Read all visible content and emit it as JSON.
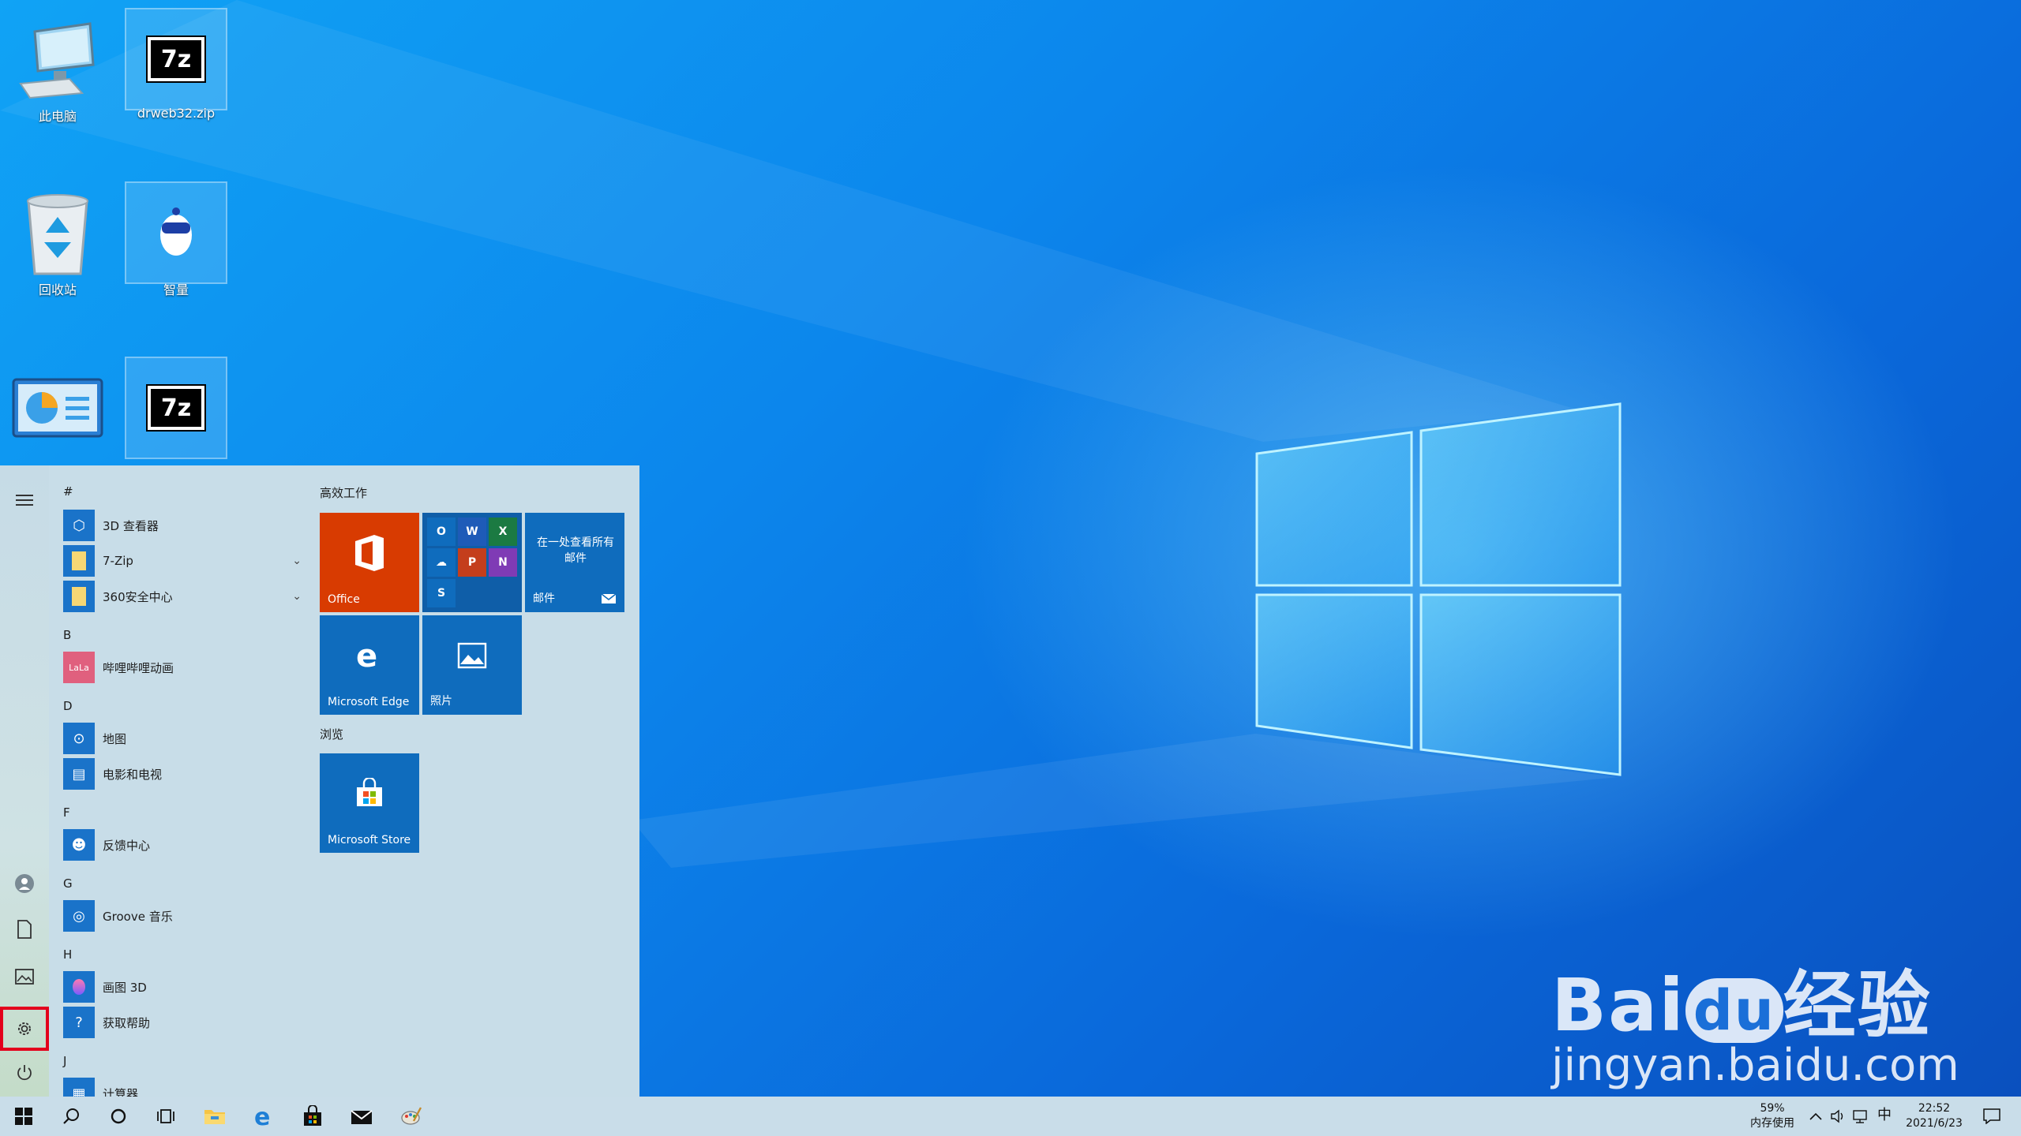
{
  "desktop": {
    "icons": [
      {
        "label": "此电脑",
        "icon": "computer-icon"
      },
      {
        "label": "drweb32.zip",
        "icon": "7zip-archive-icon"
      },
      {
        "label": "回收站",
        "icon": "recycle-bin-icon"
      },
      {
        "label": "智量",
        "icon": "zhiliang-mascot-icon"
      },
      {
        "label": "",
        "icon": "control-panel-icon"
      },
      {
        "label": "",
        "icon": "7zip-archive-icon"
      }
    ]
  },
  "start_menu": {
    "rail": {
      "icons": [
        "hamburger-menu-icon",
        "user-avatar-icon",
        "documents-icon",
        "pictures-icon",
        "settings-icon",
        "power-icon"
      ],
      "highlighted": "settings-icon"
    },
    "app_list": [
      {
        "letter": "#"
      },
      {
        "name": "3D 查看器",
        "icon": "3d-viewer-icon"
      },
      {
        "name": "7-Zip",
        "icon": "folder-icon",
        "expandable": true
      },
      {
        "name": "360安全中心",
        "icon": "folder-icon",
        "expandable": true
      },
      {
        "letter": "B"
      },
      {
        "name": "哔哩哔哩动画",
        "icon": "bilibili-icon"
      },
      {
        "letter": "D"
      },
      {
        "name": "地图",
        "icon": "maps-icon"
      },
      {
        "name": "电影和电视",
        "icon": "movies-tv-icon"
      },
      {
        "letter": "F"
      },
      {
        "name": "反馈中心",
        "icon": "feedback-hub-icon"
      },
      {
        "letter": "G"
      },
      {
        "name": "Groove 音乐",
        "icon": "groove-music-icon"
      },
      {
        "letter": "H"
      },
      {
        "name": "画图 3D",
        "icon": "paint-3d-icon"
      },
      {
        "name": "获取帮助",
        "icon": "get-help-icon"
      },
      {
        "letter": "J"
      },
      {
        "name": "计算器",
        "icon": "calculator-icon"
      }
    ],
    "tile_groups": [
      {
        "title": "高效工作",
        "tiles": [
          {
            "label": "Office",
            "color": "#d83b01",
            "icon": "office-icon"
          },
          {
            "label": "",
            "color": "#0f5ea8",
            "icon": "office-apps-folder-icon",
            "apps": [
              "O",
              "W",
              "X",
              "☁",
              "P",
              "N",
              "S"
            ]
          },
          {
            "label": "邮件",
            "color": "#0f6cbd",
            "icon": "mail-icon",
            "text": "在一处查看所有邮件"
          },
          {
            "label": "Microsoft Edge",
            "color": "#0f6cbd",
            "icon": "edge-icon"
          },
          {
            "label": "照片",
            "color": "#0f6cbd",
            "icon": "photos-icon"
          }
        ]
      },
      {
        "title": "浏览",
        "tiles": [
          {
            "label": "Microsoft Store",
            "color": "#0f6cbd",
            "icon": "store-icon"
          }
        ]
      }
    ]
  },
  "taskbar": {
    "items": [
      "start-button-icon",
      "search-icon",
      "cortana-icon",
      "task-view-icon",
      "file-explorer-icon",
      "edge-icon",
      "store-icon",
      "mail-icon",
      "paint-icon"
    ],
    "tray": {
      "memory_percent": "59%",
      "memory_label": "内存使用",
      "ime": "中",
      "time": "22:52",
      "date": "2021/6/23"
    }
  },
  "watermark": {
    "brand": "Bai",
    "brand_paw": "du",
    "cn": "经验",
    "url": "jingyan.baidu.com"
  },
  "colors": {
    "start_bg": "#c8dde8",
    "tile_blue": "#0f6cbd",
    "office_orange": "#d83b01",
    "highlight_red": "#e3001b"
  }
}
